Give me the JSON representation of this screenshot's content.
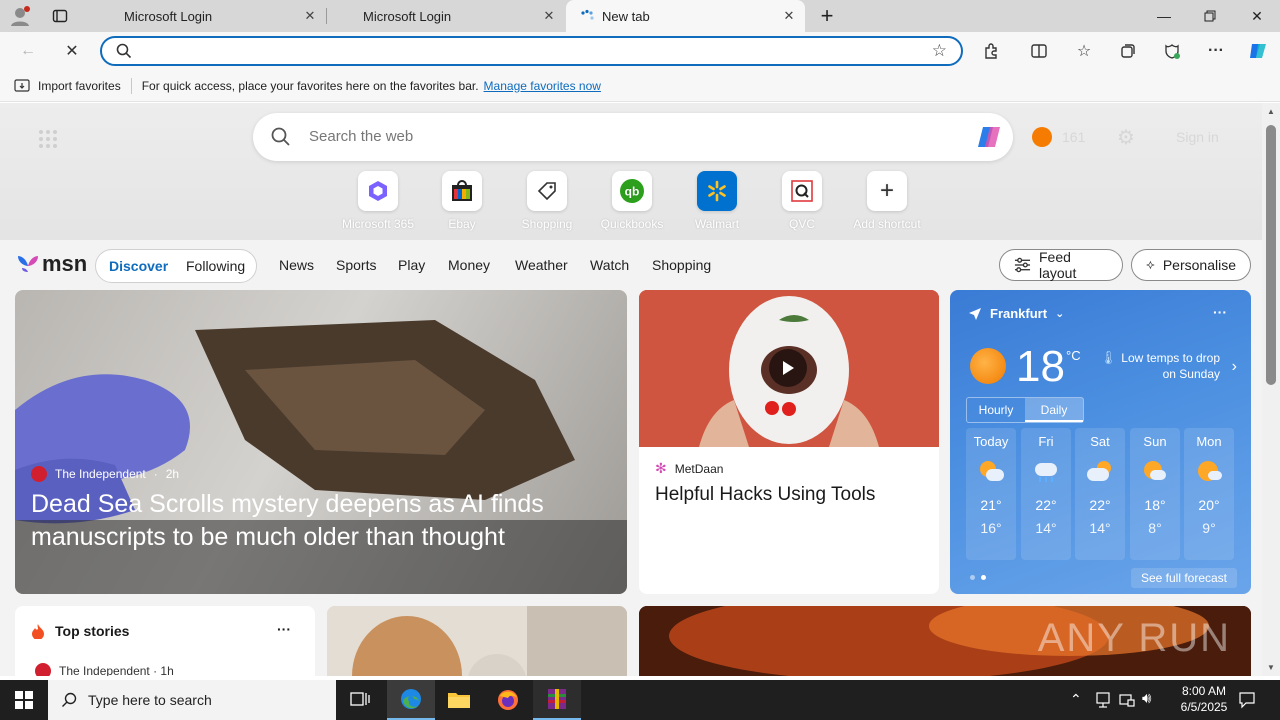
{
  "tabs": [
    {
      "title": "Microsoft Login"
    },
    {
      "title": "Microsoft Login"
    },
    {
      "title": "New tab"
    }
  ],
  "favbar": {
    "import": "Import favorites",
    "hint": "For quick access, place your favorites here on the favorites bar.",
    "manage": "Manage favorites now"
  },
  "newtab": {
    "search_placeholder": "Search the web",
    "points": "161",
    "sign_in": "Sign in",
    "shortcuts": [
      {
        "label": "Microsoft 365"
      },
      {
        "label": "Ebay"
      },
      {
        "label": "Shopping"
      },
      {
        "label": "Quickbooks"
      },
      {
        "label": "Walmart"
      },
      {
        "label": "QVC"
      },
      {
        "label": "Add shortcut"
      }
    ]
  },
  "msn": {
    "logo": "msn",
    "tabs": [
      "Discover",
      "Following"
    ],
    "nav": [
      "News",
      "Sports",
      "Play",
      "Money",
      "Weather",
      "Watch",
      "Shopping"
    ],
    "feed_layout": "Feed layout",
    "personalise": "Personalise"
  },
  "hero": {
    "source": "The Independent",
    "age": "2h",
    "title": "Dead Sea Scrolls mystery deepens as AI finds manuscripts to be much older than thought"
  },
  "video_card": {
    "source": "MetDaan",
    "title": "Helpful Hacks Using Tools"
  },
  "weather": {
    "city": "Frankfurt",
    "temp": "18",
    "unit": "°C",
    "alert": "Low temps to drop on Sunday",
    "mode_hourly": "Hourly",
    "mode_daily": "Daily",
    "days": [
      {
        "day": "Today",
        "high": "21°",
        "low": "16°"
      },
      {
        "day": "Fri",
        "high": "22°",
        "low": "14°"
      },
      {
        "day": "Sat",
        "high": "22°",
        "low": "14°"
      },
      {
        "day": "Sun",
        "high": "18°",
        "low": "8°"
      },
      {
        "day": "Mon",
        "high": "20°",
        "low": "9°"
      }
    ],
    "full_forecast": "See full forecast"
  },
  "top_stories": {
    "title": "Top stories",
    "source": "The Independent · 1h"
  },
  "watermark": "ANY RUN",
  "taskbar": {
    "search_placeholder": "Type here to search",
    "time": "8:00 AM",
    "date": "6/5/2025"
  },
  "colors": {
    "accent": "#0f6cbd",
    "weather_bg": "#3a7bd5",
    "taskbar": "#1f1f1f"
  }
}
